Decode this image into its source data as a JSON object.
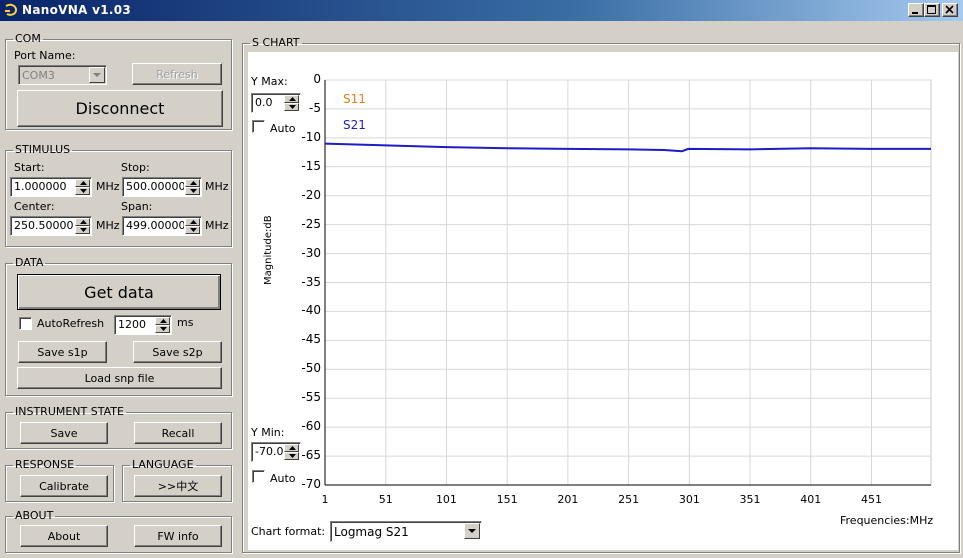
{
  "window": {
    "title": "NanoVNA  v1.03"
  },
  "com": {
    "legend": "COM",
    "port_label": "Port Name:",
    "port_value": "COM3",
    "refresh_label": "Refresh",
    "disconnect_label": "Disconnect"
  },
  "stimulus": {
    "legend": "STIMULUS",
    "start_label": "Start:",
    "start_value": "1.000000",
    "stop_label": "Stop:",
    "stop_value": "500.000000",
    "center_label": "Center:",
    "center_value": "250.500000",
    "span_label": "Span:",
    "span_value": "499.000000",
    "unit": "MHz"
  },
  "data": {
    "legend": "DATA",
    "get_data_label": "Get data",
    "autorefresh_label": "AutoRefresh",
    "autorefresh_checked": false,
    "interval_value": "1200",
    "interval_unit": "ms",
    "save_s1p_label": "Save s1p",
    "save_s2p_label": "Save s2p",
    "load_snp_label": "Load snp file"
  },
  "instrument_state": {
    "legend": "INSTRUMENT STATE",
    "save_label": "Save",
    "recall_label": "Recall"
  },
  "response": {
    "legend": "RESPONSE",
    "calibrate_label": "Calibrate"
  },
  "language": {
    "legend": "LANGUAGE",
    "switch_label": ">>中文"
  },
  "about": {
    "legend": "ABOUT",
    "about_label": "About",
    "fw_info_label": "FW info"
  },
  "chart": {
    "legend": "S CHART",
    "ymax_label": "Y Max:",
    "ymax_value": "0.0",
    "ymin_label": "Y Min:",
    "ymin_value": "-70.0",
    "auto_label": "Auto",
    "chart_format_label": "Chart format:",
    "chart_format_value": "Logmag S21"
  },
  "chart_data": {
    "type": "line",
    "ylabel": "Magnitude:dB",
    "xlabel": "Frequencies:MHz",
    "ylim": [
      -70,
      0
    ],
    "xlim": [
      1,
      500
    ],
    "y_ticks": [
      "0",
      "-5",
      "-10",
      "-15",
      "-20",
      "-25",
      "-30",
      "-35",
      "-40",
      "-45",
      "-50",
      "-55",
      "-60",
      "-65",
      "-70"
    ],
    "x_ticks": [
      "1",
      "51",
      "101",
      "151",
      "201",
      "251",
      "301",
      "351",
      "401",
      "451"
    ],
    "grid": true,
    "series": [
      {
        "name": "S11",
        "color": "#e0801a",
        "x": [],
        "y": []
      },
      {
        "name": "S21",
        "color": "#1c1cc8",
        "x": [
          1,
          51,
          101,
          151,
          201,
          251,
          280,
          295,
          300,
          351,
          401,
          451,
          500
        ],
        "y": [
          -11.0,
          -11.3,
          -11.6,
          -11.8,
          -11.9,
          -12.0,
          -12.1,
          -12.3,
          -11.9,
          -12.0,
          -11.8,
          -11.9,
          -11.9
        ]
      }
    ]
  }
}
